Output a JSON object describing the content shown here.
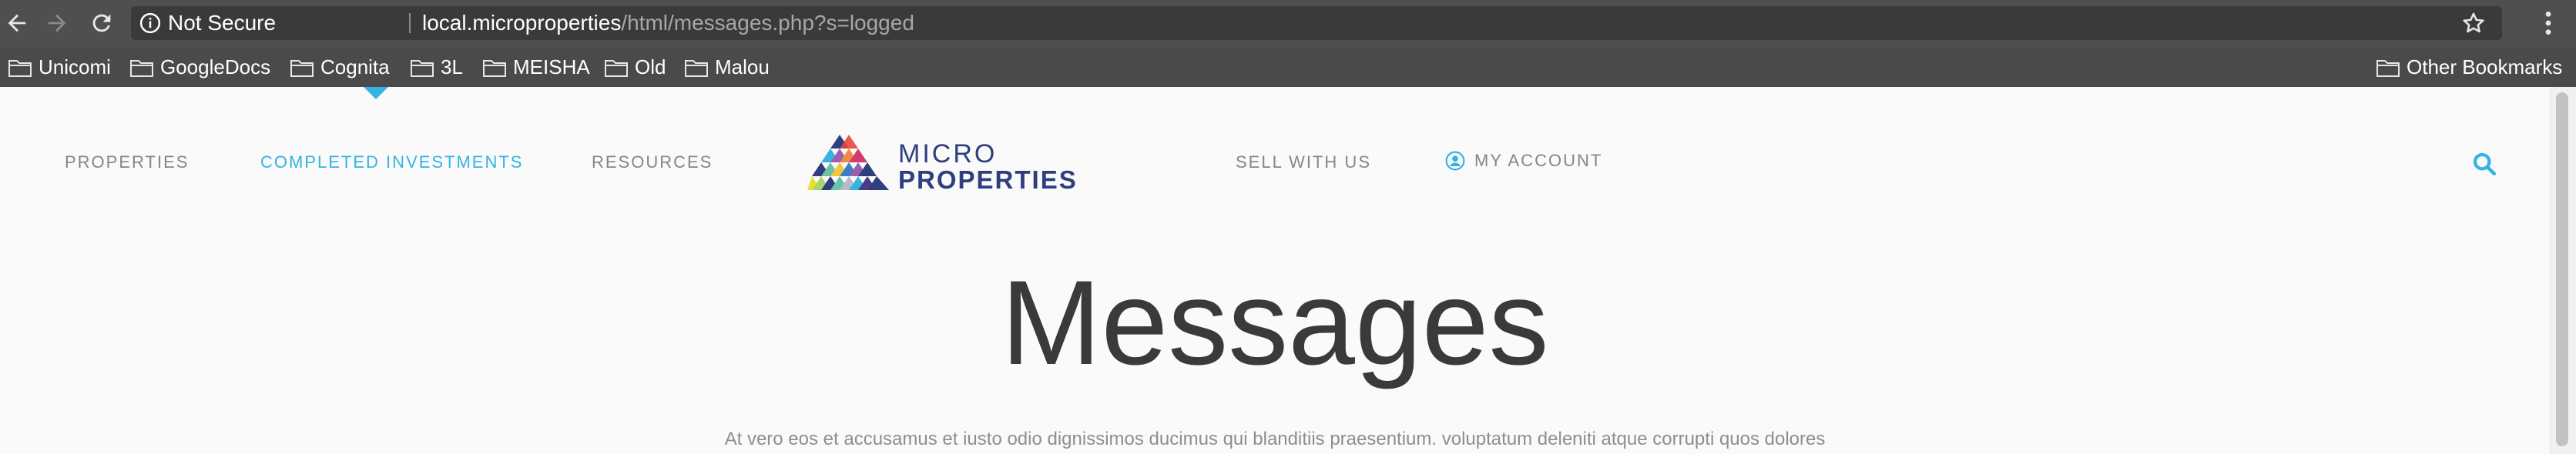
{
  "browser": {
    "security_label": "Not Secure",
    "url_host": "local.microproperties",
    "url_path": "/html/messages.php?s=logged",
    "bookmarks": [
      "Unicomi",
      "GoogleDocs",
      "Cognita",
      "3L",
      "MEISHA",
      "Old",
      "Malou"
    ],
    "other_bookmarks": "Other Bookmarks"
  },
  "site": {
    "nav": {
      "properties": "PROPERTIES",
      "completed_investments": "COMPLETED INVESTMENTS",
      "resources": "RESOURCES",
      "sell_with_us": "SELL WITH US",
      "my_account": "MY ACCOUNT"
    },
    "logo": {
      "line1": "MICRO",
      "line2": "PROPERTIES"
    },
    "accent_color": "#35b3e2",
    "brand_color": "#2e3e7e"
  },
  "page": {
    "title": "Messages",
    "intro": "At vero eos et accusamus et iusto odio dignissimos ducimus qui blanditiis praesentium. voluptatum deleniti atque corrupti quos dolores"
  }
}
